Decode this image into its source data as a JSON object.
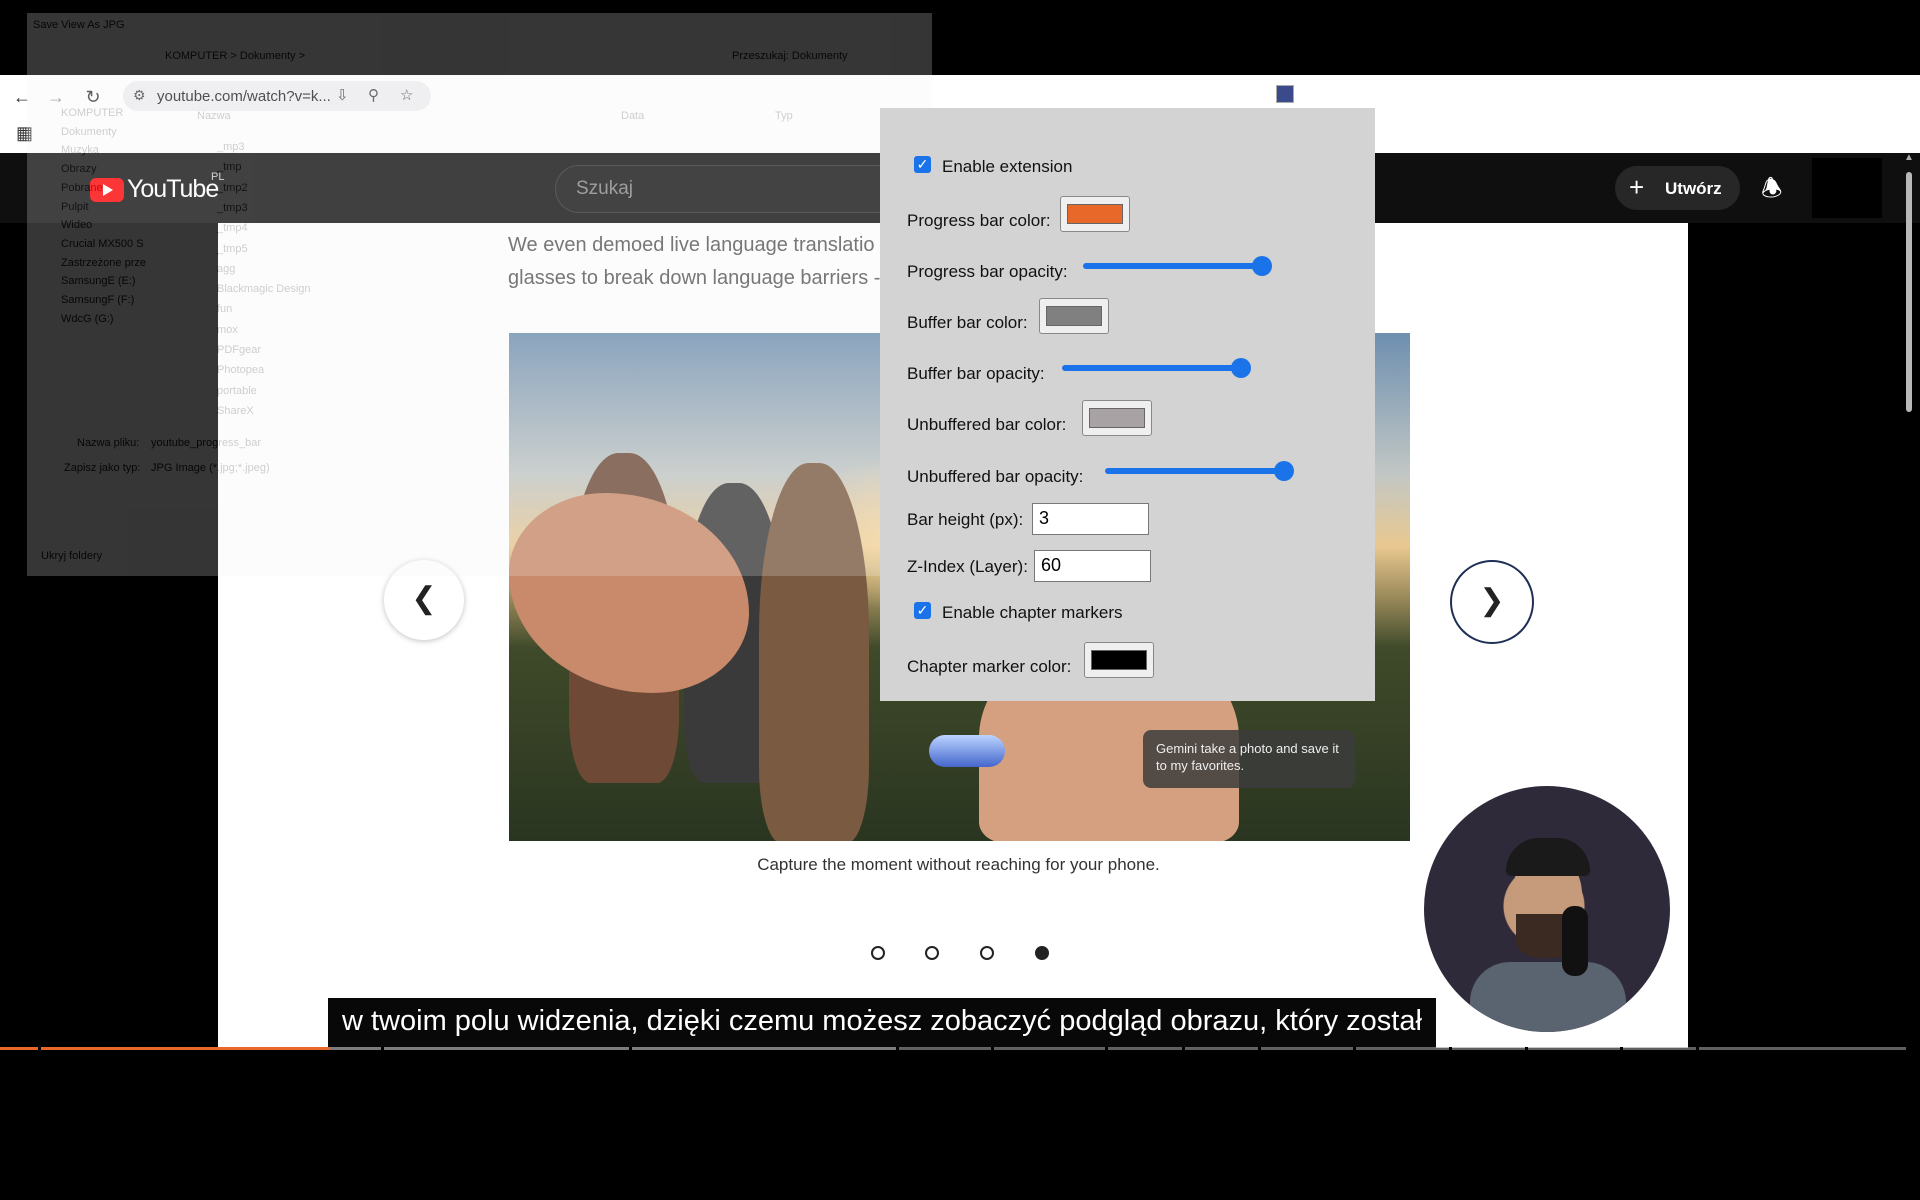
{
  "browser": {
    "url": "youtube.com/watch?v=k...",
    "nav_back_icon": "arrow-left-icon",
    "nav_forward_icon": "arrow-right-icon",
    "reload_icon": "reload-icon"
  },
  "save_dialog": {
    "title": "Save View As JPG",
    "breadcrumb": "KOMPUTER  >  Dokumenty  >",
    "search_placeholder": "Przeszukaj: Dokumenty",
    "col_name": "Nazwa",
    "col_date": "Data",
    "col_type": "Typ",
    "filename_label": "Nazwa pliku:",
    "filename_value": "youtube_progress_bar",
    "type_label": "Zapisz jako typ:",
    "type_value": "JPG Image (*.jpg;*.jpeg)",
    "hide_folders": "Ukryj foldery",
    "sidebar": [
      "KOMPUTER",
      "Dokumenty",
      "Muzyka",
      "Obrazy",
      "Pobrane",
      "Pulpit",
      "Wideo",
      "Crucial MX500 S",
      "Zastrzeżone prze",
      "SamsungE (E:)",
      "SamsungF (F:)",
      "WdcG (G:)"
    ],
    "files": [
      "_mp3",
      "_tmp",
      "_tmp2",
      "_tmp3",
      "_tmp4",
      "_tmp5",
      "agg",
      "Blackmagic Design",
      "fun",
      "mox",
      "PDFgear",
      "Photopea",
      "portable",
      "ShareX"
    ]
  },
  "youtube": {
    "logo": "YouTube",
    "region": "PL",
    "search_placeholder": "Szukaj",
    "create_label": "Utwórz",
    "create_icon": "plus-icon",
    "bell_icon": "bell-icon"
  },
  "video": {
    "slide_text_line1": "We even demoed live language translatio",
    "slide_text_line2": "glasses to break down language barriers -",
    "bubble_text": "Gemini take a photo and save it to my favorites.",
    "caption": "Capture the moment without reaching for your phone.",
    "prev_icon": "chevron-left-icon",
    "next_icon": "chevron-right-icon",
    "dots": 4,
    "active_dot": 4,
    "subtitle": "w twoim polu widzenia, dzięki czemu możesz zobaczyć podgląd obrazu, który został"
  },
  "progress": {
    "played_fraction": 0.173,
    "buffered_fraction": 0.47,
    "played_color": "#e8682a",
    "buffer_color": "#808080",
    "unbuffered_color": "#a0a0a0",
    "chapter_marker_color": "#000000"
  },
  "extension": {
    "enable_label": "Enable extension",
    "enable_checked": true,
    "progress_color_label": "Progress bar color:",
    "progress_color": "#e8682a",
    "progress_opacity_label": "Progress bar opacity:",
    "progress_opacity": 1.0,
    "buffer_color_label": "Buffer bar color:",
    "buffer_color": "#808080",
    "buffer_opacity_label": "Buffer bar opacity:",
    "buffer_opacity": 1.0,
    "unbuffered_color_label": "Unbuffered bar color:",
    "unbuffered_color": "#a9a2a4",
    "unbuffered_opacity_label": "Unbuffered bar opacity:",
    "unbuffered_opacity": 1.0,
    "bar_height_label": "Bar height (px):",
    "bar_height": "3",
    "zindex_label": "Z-Index (Layer):",
    "zindex": "60",
    "chapter_markers_label": "Enable chapter markers",
    "chapter_markers_checked": true,
    "chapter_color_label": "Chapter marker color:",
    "chapter_color": "#000000"
  }
}
